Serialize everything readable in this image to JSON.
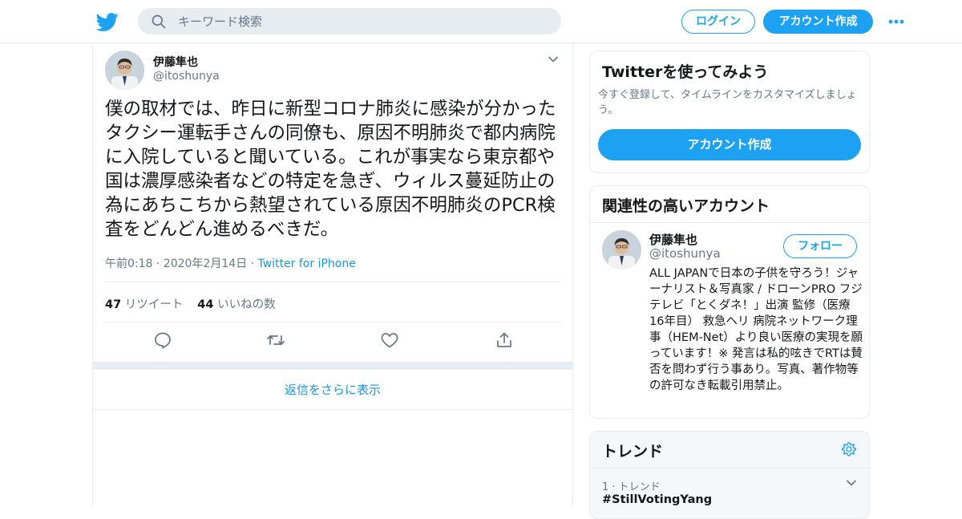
{
  "header": {
    "search_placeholder": "キーワード検索",
    "login_label": "ログイン",
    "signup_label": "アカウント作成"
  },
  "tweet": {
    "author_name": "伊藤隼也",
    "author_handle": "@itoshunya",
    "text": "僕の取材では、昨日に新型コロナ肺炎に感染が分かったタクシー運転手さんの同僚も、原因不明肺炎で都内病院に入院していると聞いている。これが事実なら東京都や国は濃厚感染者などの特定を急ぎ、ウィルス蔓延防止の為にあちこちから熱望されている原因不明肺炎のPCR検査をどんどん進めるべきだ。",
    "timestamp": "午前0:18 · 2020年2月14日",
    "separator": "·",
    "source": "Twitter for iPhone",
    "retweet_count": "47",
    "retweet_label": "リツイート",
    "like_count": "44",
    "like_label": "いいねの数"
  },
  "show_more_replies": "返信をさらに表示",
  "sidebar": {
    "try_twitter": {
      "title": "Twitterを使ってみよう",
      "description": "今すぐ登録して、タイムラインをカスタマイズしましょう。",
      "button_label": "アカウント作成"
    },
    "related_accounts": {
      "title": "関連性の高いアカウント",
      "name": "伊藤隼也",
      "handle": "@itoshunya",
      "follow_label": "フォロー",
      "bio": "ALL JAPANで日本の子供を守ろう！ジャーナリスト＆写真家 / ドローンPRO フジテレビ「とくダネ！」出演 監修（医療 16年目） 救急ヘリ 病院ネットワーク理事（HEM-Net）より良い医療の実現を願っています！※ 発言は私的呟きでRTは賛否を問わず行う事あり。写真、著作物等の許可なき転載引用禁止。"
    },
    "trends": {
      "title": "トレンド",
      "rank_label": "1 · トレンド",
      "tag": "#StillVotingYang"
    }
  },
  "colors": {
    "brand": "#1da1f2",
    "link": "#1b95e0",
    "muted": "#657786",
    "border": "#e6ecf0"
  },
  "icons": [
    "twitter-bird-icon",
    "search-icon",
    "more-dots-icon",
    "chevron-down-icon",
    "reply-icon",
    "retweet-icon",
    "like-heart-icon",
    "share-icon",
    "gear-icon"
  ]
}
